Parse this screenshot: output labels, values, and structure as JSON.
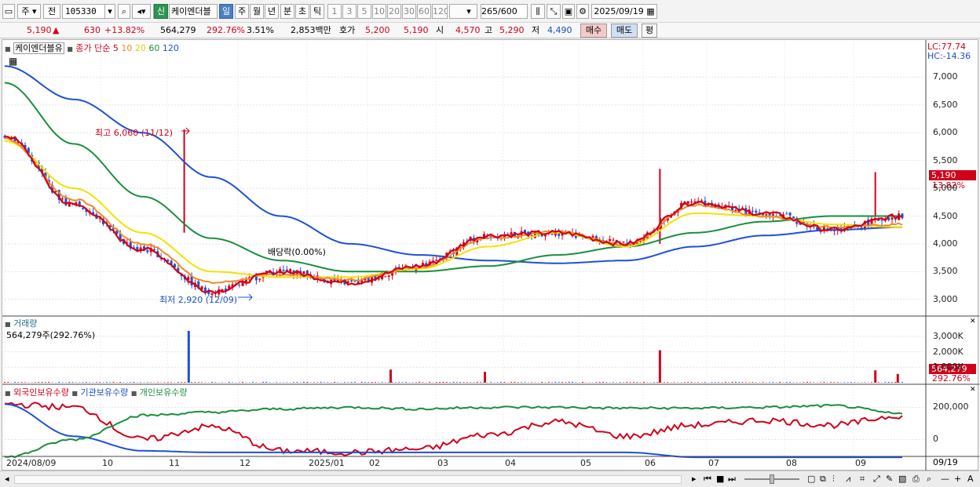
{
  "toolbar": {
    "period_label": "주",
    "prev_label": "전",
    "code": "105330",
    "new_badge": "신",
    "stock_name": "케이엔더블",
    "units": [
      "일",
      "주",
      "월",
      "년",
      "분",
      "초",
      "틱"
    ],
    "active_unit": "일",
    "minute_options": [
      "1",
      "3",
      "5",
      "10",
      "20",
      "30",
      "60",
      "120"
    ],
    "count": "265",
    "count_total": "/600",
    "date": "2025/09/19"
  },
  "pricebar": {
    "price": "5,190",
    "change": "630",
    "change_pct": "+13.82%",
    "volume": "564,279",
    "volume_ratio": "292.76%",
    "turnover": "3.51%",
    "amount": "2,853백만",
    "hoga_label": "호가",
    "hoga_ask": "5,200",
    "hoga_bid": "5,190",
    "open_label": "시",
    "open": "4,570",
    "high_label": "고",
    "high": "5,290",
    "low_label": "저",
    "low": "4,490",
    "buy_button": "매수",
    "sell_button": "매도",
    "avg_button": "평"
  },
  "price_panel": {
    "stock_label": "케이엔더블유",
    "ma_title": "종가 단순",
    "ma_periods": [
      "5",
      "10",
      "20",
      "60",
      "120"
    ],
    "ma_colors": [
      "#d0021b",
      "#f08a24",
      "#f2e200",
      "#1a8f3c",
      "#1f4fd6"
    ],
    "lc_label": "LC:77.74",
    "hc_label": "HC:-14.36",
    "high_annot": "최고 6,060 (11/12)",
    "low_annot": "최저 2,920 (12/09)",
    "dividend_annot": "배당락(0.00%)",
    "last_price_tag": "5,190",
    "last_pct_tag": "13.82%"
  },
  "volume_panel": {
    "title": "거래량",
    "value": "564,279주(292.76%)",
    "ticks": [
      "3,000K",
      "2,000K",
      "1,000K"
    ],
    "last_tag": "564,279",
    "last_pct_tag": "292.76%"
  },
  "holding_panel": {
    "foreign_label": "외국인보유수량",
    "inst_label": "기관보유수량",
    "retail_label": "개인보유수량",
    "ticks": [
      "200,000",
      "0"
    ]
  },
  "x_axis": {
    "labels": [
      "2024/08/09",
      "10",
      "11",
      "12",
      "2025/01",
      "02",
      "03",
      "04",
      "05",
      "06",
      "07",
      "08",
      "09"
    ],
    "last_label": "09/19"
  },
  "chart_data": [
    {
      "type": "line",
      "title": "케이엔더블유",
      "x": [
        "2024/08/09",
        "2024/10",
        "2024/11",
        "2024/12",
        "2025/01",
        "2025/02",
        "2025/03",
        "2025/04",
        "2025/05",
        "2025/06",
        "2025/07",
        "2025/08",
        "2025/09",
        "2025/09/19"
      ],
      "ylim": [
        2700,
        7500
      ],
      "y_ticks": [
        3000,
        3500,
        4000,
        4500,
        5000,
        5500,
        6000,
        6500,
        7000
      ],
      "series": [
        {
          "name": "5",
          "values": [
            5950,
            4700,
            3900,
            3150,
            3500,
            3300,
            3600,
            4150,
            4200,
            4000,
            4750,
            4550,
            4250,
            4500
          ]
        },
        {
          "name": "10",
          "values": [
            5900,
            4800,
            4000,
            3300,
            3450,
            3350,
            3580,
            4100,
            4220,
            3980,
            4700,
            4500,
            4300,
            4350
          ]
        },
        {
          "name": "20",
          "values": [
            5850,
            5000,
            4200,
            3500,
            3400,
            3400,
            3550,
            3950,
            4200,
            3950,
            4550,
            4500,
            4350,
            4300
          ]
        },
        {
          "name": "60",
          "values": [
            6900,
            5800,
            4850,
            4100,
            3700,
            3500,
            3500,
            3600,
            3800,
            3950,
            4200,
            4400,
            4500,
            4500
          ]
        },
        {
          "name": "120",
          "values": [
            7200,
            6600,
            6000,
            5200,
            4500,
            4000,
            3800,
            3700,
            3650,
            3700,
            3950,
            4150,
            4250,
            4300
          ]
        }
      ]
    },
    {
      "type": "bar",
      "title": "거래량",
      "ylim": [
        0,
        3500
      ],
      "y_ticks": [
        1000,
        2000,
        3000
      ],
      "spikes_k": [
        [
          "2024/11/12",
          3350
        ],
        [
          "2025/02",
          850
        ],
        [
          "2025/06",
          2100
        ],
        [
          "2025/09/19",
          564
        ]
      ]
    },
    {
      "type": "line",
      "title": "보유수량",
      "ylim": [
        -100000,
        280000
      ],
      "y_ticks": [
        0,
        200000
      ],
      "series": [
        {
          "name": "외국인보유수량",
          "values": [
            220000,
            200000,
            0,
            80000,
            -70000,
            -80000,
            -60000,
            30000,
            110000,
            20000,
            90000,
            120000,
            90000,
            150000
          ]
        },
        {
          "name": "기관보유수량",
          "values": [
            220000,
            20000,
            -70000,
            -80000,
            -80000,
            -80000,
            -80000,
            -80000,
            -80000,
            -80000,
            -110000,
            -110000,
            -110000,
            -110000
          ]
        },
        {
          "name": "개인보유수량",
          "values": [
            -110000,
            0,
            150000,
            170000,
            190000,
            200000,
            190000,
            200000,
            200000,
            195000,
            195000,
            200000,
            210000,
            160000
          ]
        }
      ]
    }
  ]
}
